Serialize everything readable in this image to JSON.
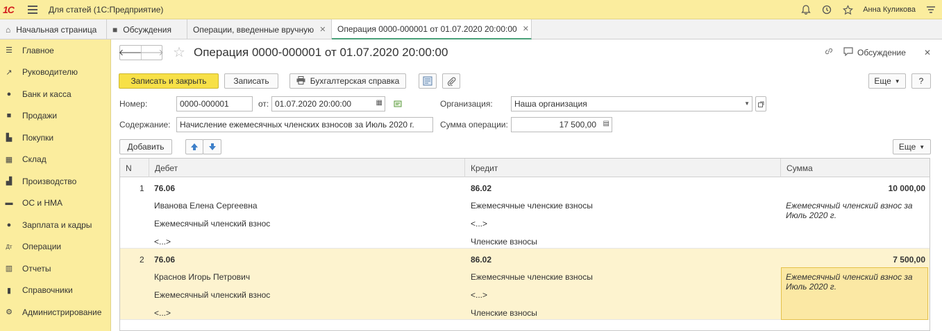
{
  "titlebar": {
    "logo": "1С",
    "app_title": "Для статей  (1С:Предприятие)",
    "user": "Анна Куликова",
    "icons": [
      "bell-icon",
      "history-icon",
      "star-icon",
      "settings-icon"
    ]
  },
  "tabs": [
    {
      "label": "Начальная страница",
      "icon": "home-icon"
    },
    {
      "label": "Обсуждения",
      "icon": "chat-icon"
    },
    {
      "label": "Операции, введенные вручную",
      "closable": true
    },
    {
      "label": "Операция 0000-000001 от 01.07.2020 20:00:00",
      "closable": true,
      "active": true
    }
  ],
  "sidebar": {
    "items": [
      {
        "label": "Главное",
        "icon": "menu-icon"
      },
      {
        "label": "Руководителю",
        "icon": "chart-line-icon"
      },
      {
        "label": "Банк и касса",
        "icon": "coin-icon"
      },
      {
        "label": "Продажи",
        "icon": "bag-icon"
      },
      {
        "label": "Покупки",
        "icon": "cart-icon"
      },
      {
        "label": "Склад",
        "icon": "warehouse-icon"
      },
      {
        "label": "Производство",
        "icon": "factory-icon"
      },
      {
        "label": "ОС и НМА",
        "icon": "truck-icon"
      },
      {
        "label": "Зарплата и кадры",
        "icon": "person-icon"
      },
      {
        "label": "Операции",
        "icon": "dt-kt-icon"
      },
      {
        "label": "Отчеты",
        "icon": "bar-chart-icon"
      },
      {
        "label": "Справочники",
        "icon": "book-icon"
      },
      {
        "label": "Администрирование",
        "icon": "gear-icon"
      }
    ]
  },
  "form": {
    "title": "Операция 0000-000001 от 01.07.2020 20:00:00",
    "discussion": "Обсуждение",
    "buttons": {
      "save_close": "Записать и закрыть",
      "save": "Записать",
      "report": "Бухгалтерская справка",
      "more": "Еще",
      "help": "?",
      "add": "Добавить",
      "more2": "Еще"
    },
    "fields": {
      "number_label": "Номер:",
      "number_value": "0000-000001",
      "date_label": "от:",
      "date_value": "01.07.2020 20:00:00",
      "org_label": "Организация:",
      "org_value": "Наша организация",
      "content_label": "Содержание:",
      "content_value": "Начисление ежемесячных членских взносов за Июль 2020 г.",
      "sum_label": "Сумма операции:",
      "sum_value": "17 500,00"
    }
  },
  "table": {
    "columns": [
      "N",
      "Дебет",
      "Кредит",
      "Сумма"
    ],
    "rows": [
      {
        "n": "1",
        "debit": "76.06",
        "debit_sub1": "Иванова Елена Сергеевна",
        "debit_sub2": "Ежемесячный членский взнос",
        "debit_sub3": "<...>",
        "credit": "86.02",
        "credit_sub1": "Ежемесячные членские взносы",
        "credit_sub2": "<...>",
        "credit_sub3": "Членские взносы",
        "sum": "10 000,00",
        "comment": "Ежемесячный членский взнос за Июль 2020 г."
      },
      {
        "n": "2",
        "debit": "76.06",
        "debit_sub1": "Краснов Игорь Петрович",
        "debit_sub2": "Ежемесячный членский взнос",
        "debit_sub3": "<...>",
        "credit": "86.02",
        "credit_sub1": "Ежемесячные членские взносы",
        "credit_sub2": "<...>",
        "credit_sub3": "Членские взносы",
        "sum": "7 500,00",
        "comment": "Ежемесячный членский взнос за Июль 2020 г."
      }
    ]
  }
}
